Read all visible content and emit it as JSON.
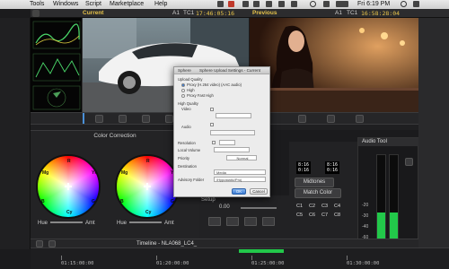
{
  "menubar": {
    "items": [
      "Tools",
      "Windows",
      "Script",
      "Marketplace",
      "Help"
    ],
    "clock": "Fri 6:19 PM"
  },
  "monitors": {
    "current": {
      "label": "Current",
      "track": "A1",
      "tc_label": "TC1",
      "timecode": "17:46:05:16"
    },
    "previous": {
      "label": "Previous",
      "track": "A1",
      "tc_label": "TC1",
      "timecode": "16:58:28:04"
    }
  },
  "color_correction": {
    "title": "Color Correction",
    "wheel_labels": [
      "R",
      "Mg",
      "B",
      "Cy",
      "G",
      "Yl"
    ],
    "hue_label": "Hue",
    "amt_label": "Amt"
  },
  "setup": {
    "title": "Setup",
    "value": "0.00"
  },
  "grade": {
    "timecodes": [
      "8:16",
      "0:16",
      "8:16",
      "0:16"
    ],
    "midtones_label": "Midtones",
    "match_color_label": "Match Color",
    "color_buttons": [
      "C1",
      "C2",
      "C3",
      "C4",
      "C5",
      "C6",
      "C7",
      "C8"
    ]
  },
  "audio_tool": {
    "title": "Audio Tool",
    "scale": [
      "-20",
      "-30",
      "-40",
      "-60"
    ],
    "left_level": 0.35,
    "right_level": 0.35,
    "status_color": "#22c84a"
  },
  "timeline": {
    "name": "Timeline - NLA068_LC4_",
    "ruler": [
      "01:15:00:00",
      "01:20:00:00",
      "01:25:00:00",
      "01:30:00:00"
    ]
  },
  "dialog": {
    "title_left": "Sphere",
    "title": "Sphere Upload Settings - Current",
    "upload_quality_label": "Upload Quality",
    "options": [
      "Proxy (H.264 video) (AAC audio)",
      "High",
      "Proxy Fast High"
    ],
    "high_quality_label": "High Quality",
    "video_label": "Video",
    "audio_label": "Audio",
    "resolution_label": "Resolution",
    "local_volume_label": "Local Volume",
    "priority_label": "Priority",
    "priority_value": "Normal",
    "destination_label": "Destination",
    "destination_value": "Media",
    "advisory_label": "Advisory Folder",
    "advisory_value": "/Hypostatic/Proj",
    "cancel_label": "Cancel",
    "ok_label": "OK"
  },
  "colors": {
    "accent_timecode": "#e6c34a",
    "meter_green": "#22c84a",
    "primary_button": "#3a7bd5"
  }
}
